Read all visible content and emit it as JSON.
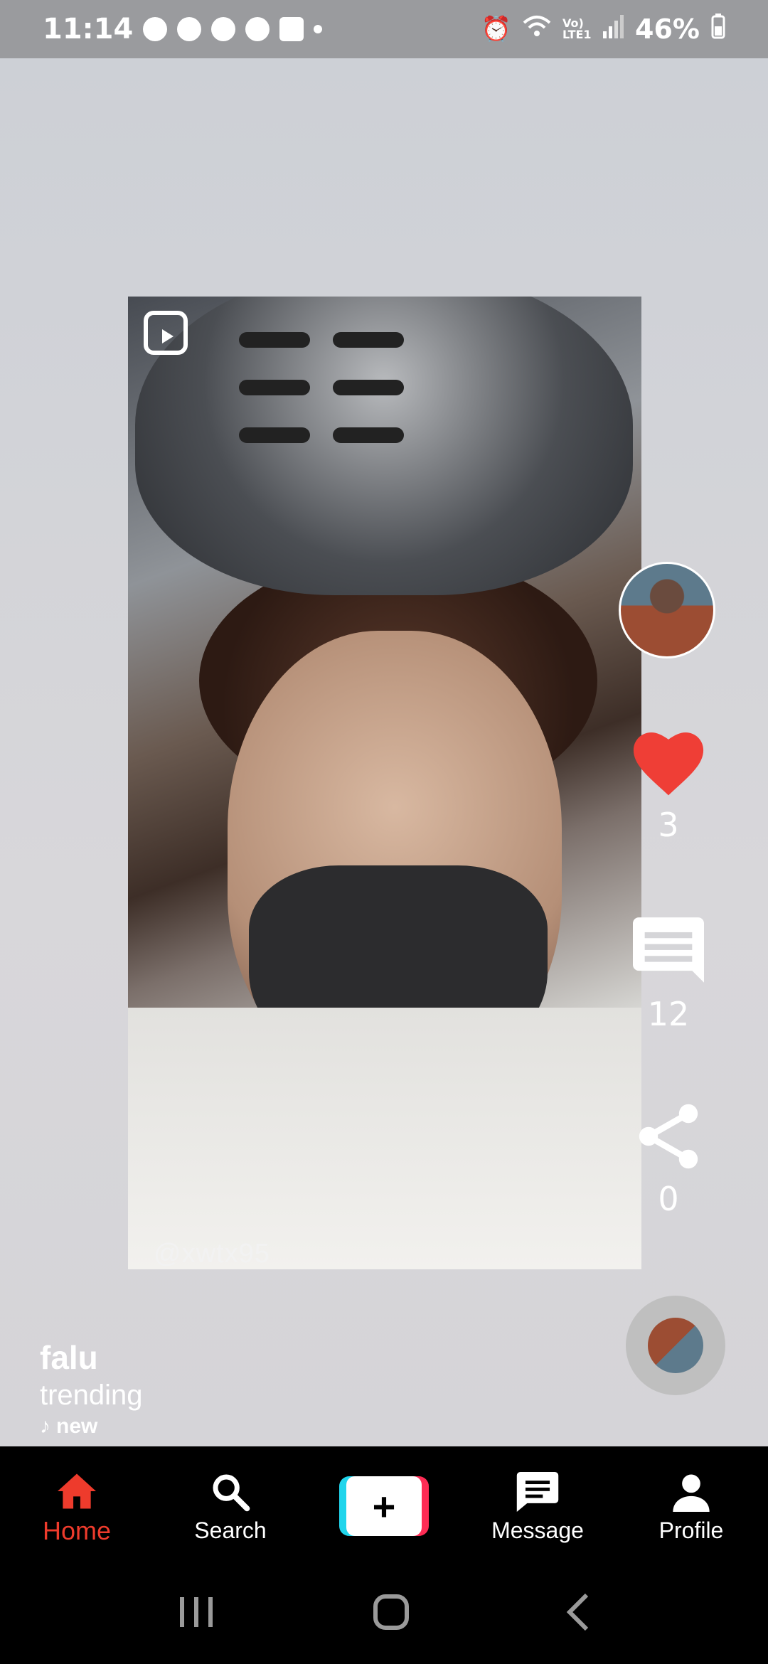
{
  "status_bar": {
    "time": "11:14",
    "battery": "46%",
    "network_label": "Vo) LTE1",
    "notification_icons": [
      "whatsapp-icon",
      "ai-icon",
      "ai-icon",
      "facebook-icon",
      "app-icon"
    ]
  },
  "video": {
    "watermark": "@xwtx95",
    "reel_icon": "reels-icon"
  },
  "actions": {
    "likes": "3",
    "comments": "12",
    "shares": "0",
    "like_color": "#ef3e36"
  },
  "caption": {
    "username": "falu",
    "description": "trending",
    "music": "new"
  },
  "bottom_nav": {
    "home": "Home",
    "search": "Search",
    "create": "+",
    "message": "Message",
    "profile": "Profile",
    "active_color": "#ee3b2c"
  }
}
